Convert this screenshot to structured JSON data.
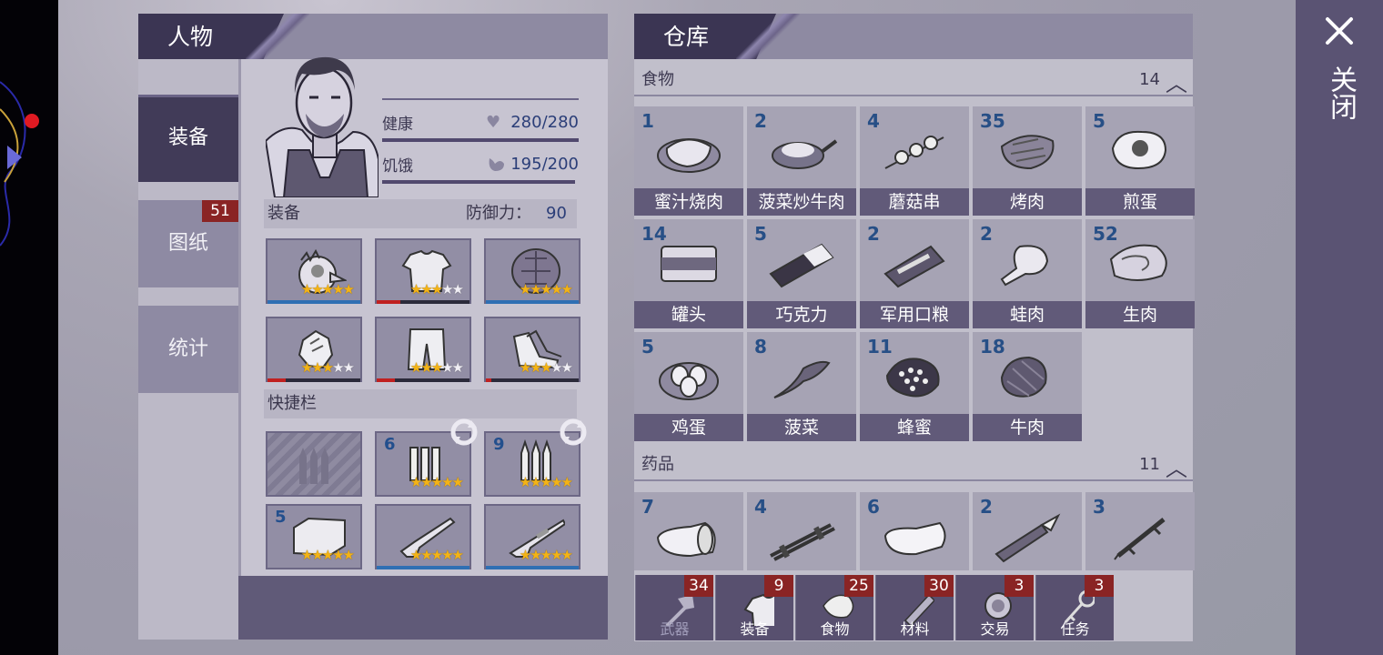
{
  "character_panel": {
    "tab_title": "人物",
    "side_tabs": [
      {
        "label": "装备",
        "active": true
      },
      {
        "label": "图纸",
        "badge": "51"
      },
      {
        "label": "统计"
      }
    ],
    "stats": [
      {
        "label": "健康",
        "value": "280/280",
        "icon": "heart-icon"
      },
      {
        "label": "饥饿",
        "value": "195/200",
        "icon": "stomach-icon"
      }
    ],
    "equipment": {
      "title": "装备",
      "defense_label": "防御力：",
      "defense_value": "90",
      "slots": [
        {
          "icon": "bird-mask-icon",
          "stars": 5,
          "durability": 1.0,
          "dur_color": "#2f6fb3"
        },
        {
          "icon": "shirt-icon",
          "stars": 3,
          "durability": 0.25,
          "dur_color": "#c02020"
        },
        {
          "icon": "turtle-shell-icon",
          "stars": 5,
          "durability": 1.0,
          "dur_color": "#2f6fb3"
        },
        {
          "icon": "gloves-icon",
          "stars": 3,
          "durability": 0.2,
          "dur_color": "#c02020"
        },
        {
          "icon": "pants-icon",
          "stars": 3,
          "durability": 0.2,
          "dur_color": "#c02020"
        },
        {
          "icon": "shoes-icon",
          "stars": 3,
          "durability": 0.06,
          "dur_color": "#c02020"
        }
      ]
    },
    "hotbar": {
      "title": "快捷栏",
      "slots": [
        {
          "icon": "empty-ammo-slot-icon",
          "count": "",
          "stars": 0
        },
        {
          "icon": "shotgun-shells-icon",
          "count": "6",
          "stars": 5,
          "swap": true
        },
        {
          "icon": "rifle-bullets-icon",
          "count": "9",
          "stars": 5,
          "swap": true
        },
        {
          "icon": "brick-icon",
          "count": "5",
          "stars": 5
        },
        {
          "icon": "shotgun-icon",
          "count": "",
          "stars": 5,
          "durability": 1.0,
          "dur_color": "#2f6fb3"
        },
        {
          "icon": "rifle-icon",
          "count": "",
          "stars": 5,
          "durability": 1.0,
          "dur_color": "#2f6fb3"
        }
      ]
    }
  },
  "storage_panel": {
    "tab_title": "仓库",
    "categories": [
      {
        "name": "食物",
        "count": "14",
        "items": [
          {
            "count": "1",
            "name": "蜜汁烧肉",
            "icon": "honey-meat-icon"
          },
          {
            "count": "2",
            "name": "菠菜炒牛肉",
            "icon": "stir-fry-pan-icon"
          },
          {
            "count": "4",
            "name": "蘑菇串",
            "icon": "mushroom-skewer-icon"
          },
          {
            "count": "35",
            "name": "烤肉",
            "icon": "roast-meat-icon"
          },
          {
            "count": "5",
            "name": "煎蛋",
            "icon": "fried-egg-icon"
          },
          {
            "count": "14",
            "name": "罐头",
            "icon": "canned-food-icon"
          },
          {
            "count": "5",
            "name": "巧克力",
            "icon": "chocolate-icon"
          },
          {
            "count": "2",
            "name": "军用口粮",
            "icon": "ration-icon"
          },
          {
            "count": "2",
            "name": "蛙肉",
            "icon": "frog-meat-icon"
          },
          {
            "count": "52",
            "name": "生肉",
            "icon": "raw-meat-icon"
          },
          {
            "count": "5",
            "name": "鸡蛋",
            "icon": "eggs-icon"
          },
          {
            "count": "8",
            "name": "菠菜",
            "icon": "spinach-icon"
          },
          {
            "count": "11",
            "name": "蜂蜜",
            "icon": "honeycomb-icon"
          },
          {
            "count": "18",
            "name": "牛肉",
            "icon": "beef-icon"
          }
        ]
      },
      {
        "name": "药品",
        "count": "11",
        "items": [
          {
            "count": "7",
            "name": "",
            "icon": "bandage-roll-icon"
          },
          {
            "count": "4",
            "name": "",
            "icon": "splint-icon"
          },
          {
            "count": "6",
            "name": "",
            "icon": "cloth-bandage-icon"
          },
          {
            "count": "2",
            "name": "",
            "icon": "herb-patch-icon"
          },
          {
            "count": "3",
            "name": "",
            "icon": "syringe-icon"
          }
        ]
      }
    ],
    "bottom_tabs": [
      {
        "label": "武器",
        "badge": "34",
        "icon": "axe-icon"
      },
      {
        "label": "装备",
        "badge": "9",
        "icon": "shirt-icon"
      },
      {
        "label": "食物",
        "badge": "25",
        "icon": "meat-icon"
      },
      {
        "label": "材料",
        "badge": "30",
        "icon": "log-icon"
      },
      {
        "label": "交易",
        "badge": "3",
        "icon": "coin-icon"
      },
      {
        "label": "任务",
        "badge": "3",
        "icon": "key-icon"
      }
    ]
  },
  "close": {
    "label": "关闭",
    "icon": "close-x-icon"
  }
}
